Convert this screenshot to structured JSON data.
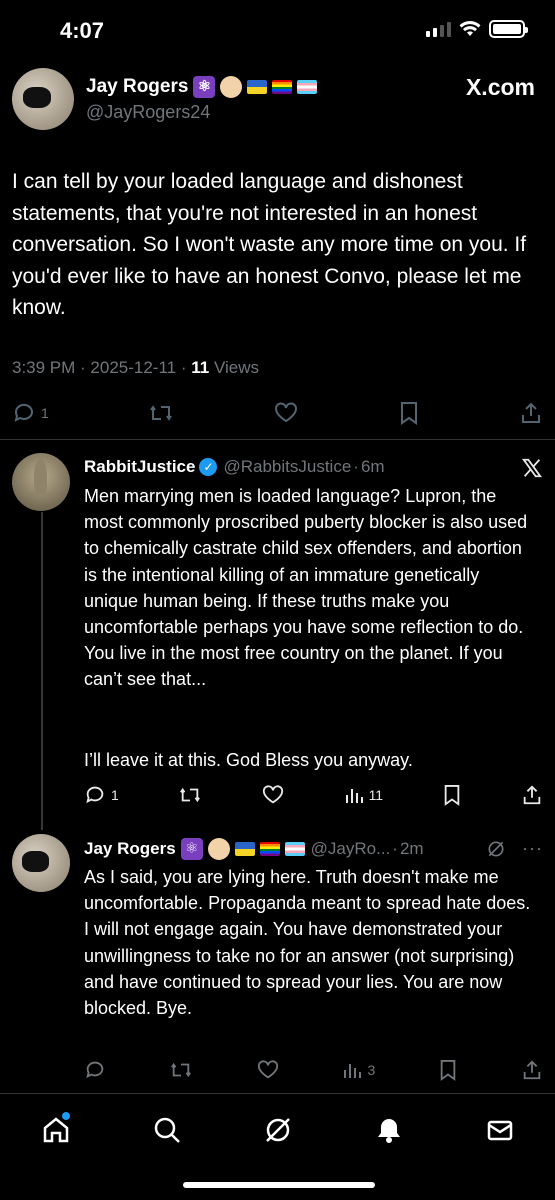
{
  "status": {
    "time": "4:07"
  },
  "header": {
    "name": "Jay Rogers",
    "handle": "@JayRogers24",
    "site": "X.com"
  },
  "main_post": {
    "text": "I can tell by your loaded language and dishonest statements, that you're not interested in an honest conversation. So I won't waste any more time on you. If you'd ever like to have an honest Convo, please let me know.",
    "time": "3:39 PM",
    "date": "2025-12-11",
    "views_count": "11",
    "views_label": "Views",
    "reply_count": "1"
  },
  "reply1": {
    "name": "RabbitJustice",
    "handle": "@RabbitsJustice",
    "age": "6m",
    "text": "Men marrying men is loaded language? Lupron, the most commonly proscribed puberty blocker is also used to chemically castrate child sex offenders, and abortion is the intentional killing of an immature genetically unique human being. If these truths make you uncomfortable perhaps you have some reflection to do. You live in the most free country on the planet. If you can’t see that...",
    "text2": "I’ll leave it at this. God Bless you anyway.",
    "reply_count": "1",
    "views": "11"
  },
  "reply2": {
    "name": "Jay Rogers",
    "handle": "@JayRo...",
    "age": "2m",
    "text": "As I said, you are lying here. Truth doesn't make me uncomfortable. Propaganda meant to spread hate does. I will not engage again. You have demonstrated your unwillingness to take no for an answer (not surprising) and have continued to spread your lies. You are now blocked. Bye.",
    "views": "3"
  },
  "nav": {
    "items": [
      "home-icon",
      "search-icon",
      "grok-icon",
      "notifications-icon",
      "messages-icon"
    ]
  },
  "colors": {
    "accent": "#1d9bf0",
    "muted": "#71767b",
    "background": "#000000"
  }
}
